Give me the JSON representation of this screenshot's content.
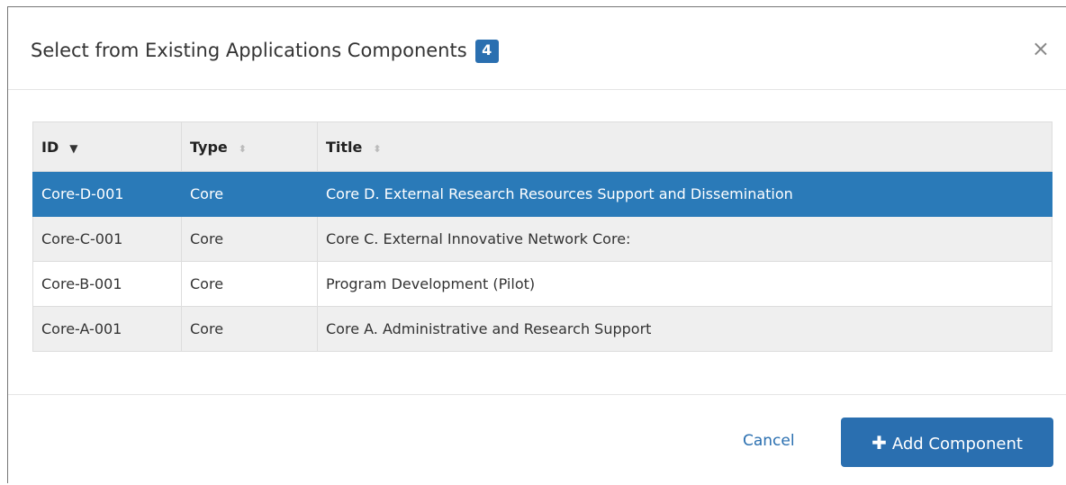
{
  "modal": {
    "title": "Select from Existing Applications Components",
    "count": "4",
    "close_glyph": "×"
  },
  "table": {
    "headers": {
      "id": "ID",
      "type": "Type",
      "title": "Title"
    },
    "sort": {
      "column": "ID",
      "direction": "descending"
    },
    "rows": [
      {
        "id": "Core-D-001",
        "type": "Core",
        "title": "Core D. External Research Resources Support and Dissemination",
        "selected": true
      },
      {
        "id": "Core-C-001",
        "type": "Core",
        "title": "Core C. External Innovative Network Core:",
        "selected": false
      },
      {
        "id": "Core-B-001",
        "type": "Core",
        "title": "Program Development (Pilot)",
        "selected": false
      },
      {
        "id": "Core-A-001",
        "type": "Core",
        "title": "Core A. Administrative and Research Support",
        "selected": false
      }
    ]
  },
  "footer": {
    "cancel_label": "Cancel",
    "add_label": "Add Component",
    "add_icon": "plus-icon"
  },
  "colors": {
    "primary": "#2a6fb0",
    "selected_row": "#2a7ab8",
    "header_bg": "#eeeeee"
  }
}
